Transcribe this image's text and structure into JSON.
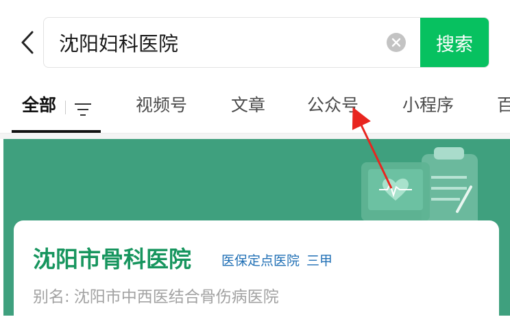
{
  "search": {
    "query": "沈阳妇科医院",
    "button_label": "搜索",
    "back_icon": "chevron-left-icon",
    "clear_icon": "clear-circle-icon"
  },
  "tabs": [
    {
      "label": "全部",
      "active": true
    },
    {
      "label": "视频号",
      "active": false
    },
    {
      "label": "文章",
      "active": false
    },
    {
      "label": "公众号",
      "active": false
    },
    {
      "label": "小程序",
      "active": false
    },
    {
      "label": "百",
      "active": false
    }
  ],
  "filter_icon": "filter-icon",
  "colors": {
    "accent_green": "#07c160",
    "banner_green": "#3fa07e",
    "title_green": "#17955e",
    "badge_blue": "#1f6fb5",
    "annotation_red": "#e8251f"
  },
  "result": {
    "name": "沈阳市骨科医院",
    "badges": [
      "医保定点医院",
      "三甲"
    ],
    "alias_label": "别名:",
    "alias_value": "沈阳市中西医结合骨伤病医院",
    "banner_icon": "medical-clipboard-heart-icon"
  }
}
